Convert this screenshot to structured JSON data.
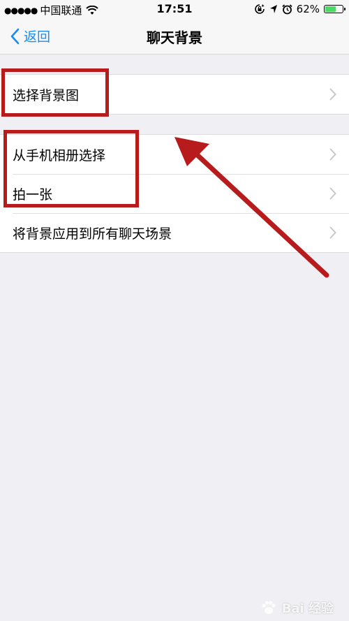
{
  "status_bar": {
    "signal_dots": "●●●●●",
    "carrier": "中国联通",
    "time": "17:51",
    "battery_percent": "62%",
    "battery_level": 0.62,
    "icons": [
      "wifi-icon",
      "rotation-lock-icon",
      "location-icon",
      "alarm-icon",
      "battery-icon"
    ]
  },
  "nav": {
    "back_label": "返回",
    "title": "聊天背景"
  },
  "groups": [
    {
      "items": [
        "选择背景图"
      ]
    },
    {
      "items": [
        "从手机相册选择",
        "拍一张",
        "将背景应用到所有聊天场景"
      ]
    }
  ],
  "colors": {
    "accent": "#1a8cf0",
    "annotation": "#b81b1b",
    "background": "#efeff4"
  },
  "watermark": {
    "text": "Bai 经验"
  }
}
